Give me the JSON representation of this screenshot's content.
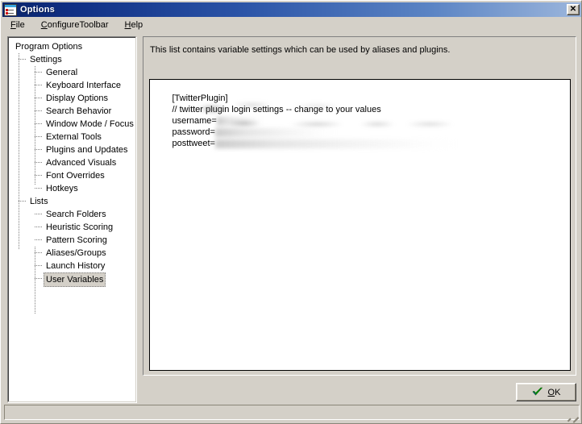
{
  "window": {
    "title": "Options",
    "icon": "options-list-icon",
    "close_label": "✕"
  },
  "menubar": {
    "items": [
      {
        "label": "File",
        "accel": "F"
      },
      {
        "label": "ConfigureToolbar",
        "accel": "C"
      },
      {
        "label": "Help",
        "accel": "H"
      }
    ]
  },
  "tree": {
    "root": "Program Options",
    "groups": [
      {
        "label": "Settings",
        "items": [
          "General",
          "Keyboard Interface",
          "Display Options",
          "Search Behavior",
          "Window Mode / Focus",
          "External Tools",
          "Plugins and Updates",
          "Advanced Visuals",
          "Font Overrides",
          "Hotkeys"
        ]
      },
      {
        "label": "Lists",
        "items": [
          "Search Folders",
          "Heuristic Scoring",
          "Pattern Scoring",
          "Aliases/Groups",
          "Launch History",
          "User Variables"
        ]
      }
    ],
    "selected": "User Variables"
  },
  "content": {
    "description": "This list contains variable settings which can be used by aliases and plugins.",
    "editor": {
      "lines": [
        {
          "text": "[TwitterPlugin]",
          "redacted": ""
        },
        {
          "text": "// twitter plugin login settings -- change to your values",
          "redacted": ""
        },
        {
          "text": "username=",
          "redacted": "r1"
        },
        {
          "text": "password=",
          "redacted": "r2"
        },
        {
          "text": "posttweet=",
          "redacted": "r3"
        }
      ]
    }
  },
  "footer": {
    "ok_label": "OK",
    "ok_accel": "O",
    "ok_icon": "green-check-icon",
    "status_text": ""
  },
  "colors": {
    "window_face": "#d4d0c8",
    "title_left": "#0a246a",
    "title_right": "#9cb6dc",
    "check_green": "#00a000",
    "selection": "#d4d0c8"
  }
}
